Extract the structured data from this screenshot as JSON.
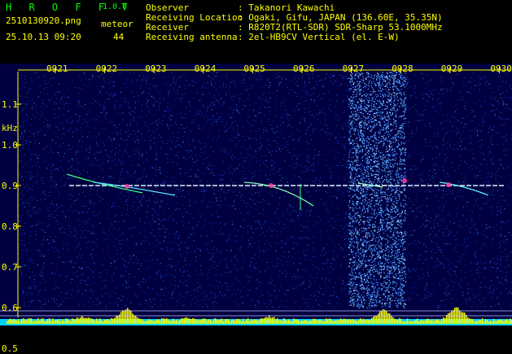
{
  "app": {
    "title": "H R O F F T",
    "version": "1.0.0"
  },
  "file": {
    "name": "2510130920.png",
    "datetime": "25.10.13 09:20"
  },
  "meteor": {
    "label": "meteor",
    "count": "44"
  },
  "info": [
    {
      "label": "Observer",
      "value": ": Takanori Kawachi"
    },
    {
      "label": "Receiving Location",
      "value": ": Ogaki, Gifu, JAPAN (136.60E, 35.35N)"
    },
    {
      "label": "Receiver",
      "value": ": R820T2(RTL-SDR) SDR-Sharp 53.1000MHz"
    },
    {
      "label": "Receiving antenna",
      "value": ": 2el-HB9CV Vertical (el. E-W)"
    }
  ],
  "chart_data": {
    "type": "heatmap",
    "ylabel": "kHz",
    "x_ticks": [
      "0921",
      "0922",
      "0923",
      "0924",
      "0925",
      "0926",
      "0927",
      "0928",
      "0929",
      "0930"
    ],
    "y_ticks": [
      "1.1",
      "1.0",
      "0.9",
      "0.8",
      "0.7",
      "0.6",
      "0.5"
    ],
    "ylim": [
      0.5,
      1.2
    ],
    "carrier_khz": 0.9,
    "colors": {
      "background": "#000040",
      "noise": "#1f3fd0",
      "axis": "#ffff00",
      "trace": "#ffffff"
    }
  }
}
